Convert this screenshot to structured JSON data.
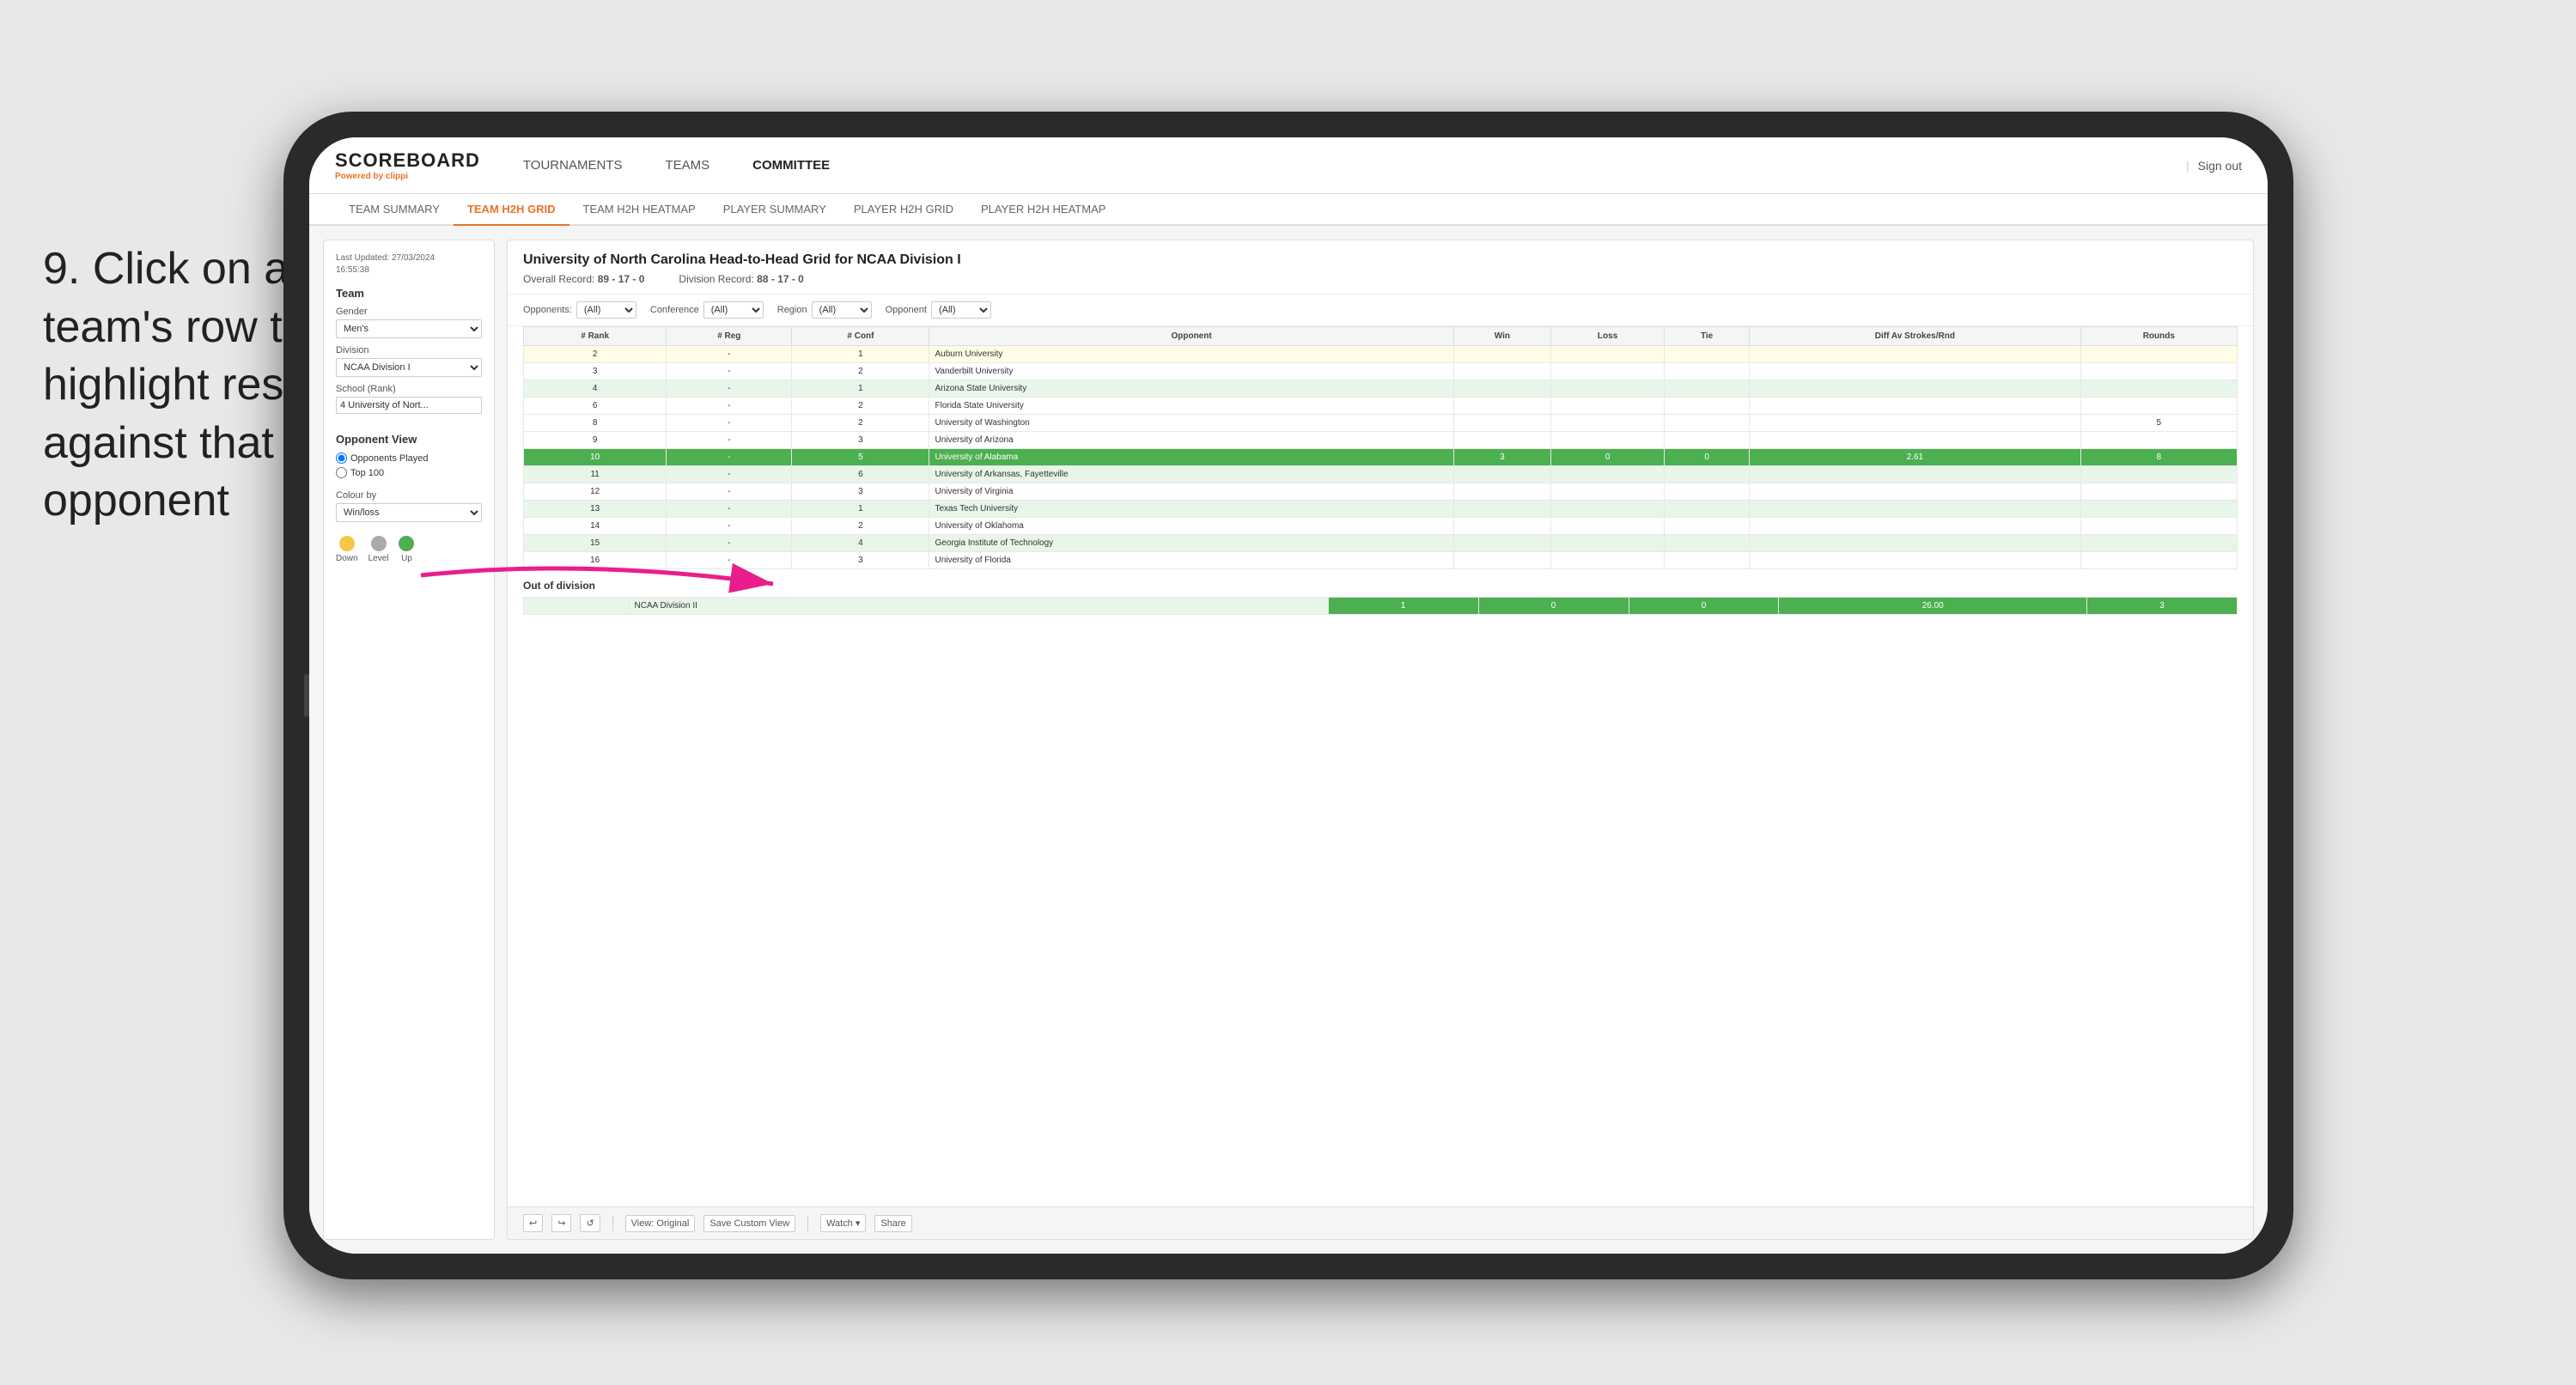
{
  "instruction": {
    "step": "9.",
    "text": "Click on a team's row to highlight results against that opponent"
  },
  "app": {
    "logo": {
      "title": "SCOREBOARD",
      "subtitle_prefix": "Powered by ",
      "subtitle_brand": "clippi"
    },
    "nav": {
      "items": [
        "TOURNAMENTS",
        "TEAMS",
        "COMMITTEE"
      ],
      "sign_out": "Sign out"
    },
    "sub_nav": {
      "items": [
        "TEAM SUMMARY",
        "TEAM H2H GRID",
        "TEAM H2H HEATMAP",
        "PLAYER SUMMARY",
        "PLAYER H2H GRID",
        "PLAYER H2H HEATMAP"
      ],
      "active": "TEAM H2H GRID"
    }
  },
  "left_panel": {
    "last_updated_label": "Last Updated: 27/03/2024",
    "last_updated_time": "16:55:38",
    "team_label": "Team",
    "gender_label": "Gender",
    "gender_value": "Men's",
    "division_label": "Division",
    "division_value": "NCAA Division I",
    "school_rank_label": "School (Rank)",
    "school_rank_value": "4 University of Nort...",
    "opponent_view_label": "Opponent View",
    "opponents_played_label": "Opponents Played",
    "top_100_label": "Top 100",
    "colour_by_label": "Colour by",
    "colour_by_value": "Win/loss",
    "legend": [
      {
        "label": "Down",
        "color": "#f4c842"
      },
      {
        "label": "Level",
        "color": "#aaa"
      },
      {
        "label": "Up",
        "color": "#4caf50"
      }
    ]
  },
  "report": {
    "title": "University of North Carolina Head-to-Head Grid for NCAA Division I",
    "overall_record_label": "Overall Record:",
    "overall_record": "89 - 17 - 0",
    "division_record_label": "Division Record:",
    "division_record": "88 - 17 - 0",
    "filters": {
      "opponents_label": "Opponents:",
      "opponents_value": "(All)",
      "conference_label": "Conference",
      "conference_value": "(All)",
      "region_label": "Region",
      "region_value": "(All)",
      "opponent_label": "Opponent",
      "opponent_value": "(All)"
    },
    "table_headers": {
      "rank": "# Rank",
      "reg": "# Reg",
      "conf": "# Conf",
      "opponent": "Opponent",
      "win": "Win",
      "loss": "Loss",
      "tie": "Tie",
      "diff_av": "Diff Av Strokes/Rnd",
      "rounds": "Rounds"
    },
    "rows": [
      {
        "rank": "2",
        "reg": "-",
        "conf": "1",
        "opponent": "Auburn University",
        "win": "",
        "loss": "",
        "tie": "",
        "diff": "",
        "rounds": "",
        "row_class": "cell-yellow-light"
      },
      {
        "rank": "3",
        "reg": "-",
        "conf": "2",
        "opponent": "Vanderbilt University",
        "win": "",
        "loss": "",
        "tie": "",
        "diff": "",
        "rounds": "",
        "row_class": ""
      },
      {
        "rank": "4",
        "reg": "-",
        "conf": "1",
        "opponent": "Arizona State University",
        "win": "",
        "loss": "",
        "tie": "",
        "diff": "",
        "rounds": "",
        "row_class": "cell-green-light"
      },
      {
        "rank": "6",
        "reg": "-",
        "conf": "2",
        "opponent": "Florida State University",
        "win": "",
        "loss": "",
        "tie": "",
        "diff": "",
        "rounds": "",
        "row_class": ""
      },
      {
        "rank": "8",
        "reg": "-",
        "conf": "2",
        "opponent": "University of Washington",
        "win": "",
        "loss": "",
        "tie": "",
        "diff": "",
        "rounds": "5",
        "row_class": ""
      },
      {
        "rank": "9",
        "reg": "-",
        "conf": "3",
        "opponent": "University of Arizona",
        "win": "",
        "loss": "",
        "tie": "",
        "diff": "",
        "rounds": "",
        "row_class": ""
      },
      {
        "rank": "10",
        "reg": "-",
        "conf": "5",
        "opponent": "University of Alabama",
        "win": "3",
        "loss": "0",
        "tie": "0",
        "diff": "2.61",
        "rounds": "8",
        "row_class": "highlighted"
      },
      {
        "rank": "11",
        "reg": "-",
        "conf": "6",
        "opponent": "University of Arkansas, Fayetteville",
        "win": "",
        "loss": "",
        "tie": "",
        "diff": "",
        "rounds": "",
        "row_class": "cell-green-light"
      },
      {
        "rank": "12",
        "reg": "-",
        "conf": "3",
        "opponent": "University of Virginia",
        "win": "",
        "loss": "",
        "tie": "",
        "diff": "",
        "rounds": "",
        "row_class": ""
      },
      {
        "rank": "13",
        "reg": "-",
        "conf": "1",
        "opponent": "Texas Tech University",
        "win": "",
        "loss": "",
        "tie": "",
        "diff": "",
        "rounds": "",
        "row_class": "cell-green-light"
      },
      {
        "rank": "14",
        "reg": "-",
        "conf": "2",
        "opponent": "University of Oklahoma",
        "win": "",
        "loss": "",
        "tie": "",
        "diff": "",
        "rounds": "",
        "row_class": ""
      },
      {
        "rank": "15",
        "reg": "-",
        "conf": "4",
        "opponent": "Georgia Institute of Technology",
        "win": "",
        "loss": "",
        "tie": "",
        "diff": "",
        "rounds": "",
        "row_class": "cell-green-light"
      },
      {
        "rank": "16",
        "reg": "-",
        "conf": "3",
        "opponent": "University of Florida",
        "win": "",
        "loss": "",
        "tie": "",
        "diff": "",
        "rounds": "",
        "row_class": ""
      }
    ],
    "out_of_division": {
      "label": "Out of division",
      "row": {
        "division": "NCAA Division II",
        "win": "1",
        "loss": "0",
        "tie": "0",
        "diff": "26.00",
        "rounds": "3"
      }
    }
  },
  "bottom_toolbar": {
    "undo": "↩",
    "redo": "↪",
    "refresh": "↺",
    "view_original": "View: Original",
    "save_custom": "Save Custom View",
    "watch": "Watch ▾",
    "share": "Share"
  },
  "colors": {
    "active_tab": "#e8732a",
    "highlighted_row": "#4caf50",
    "row_green_light": "#e8f5e9",
    "row_yellow_light": "#fffde7",
    "legend_down": "#f4c842",
    "legend_level": "#aaaaaa",
    "legend_up": "#4caf50"
  }
}
